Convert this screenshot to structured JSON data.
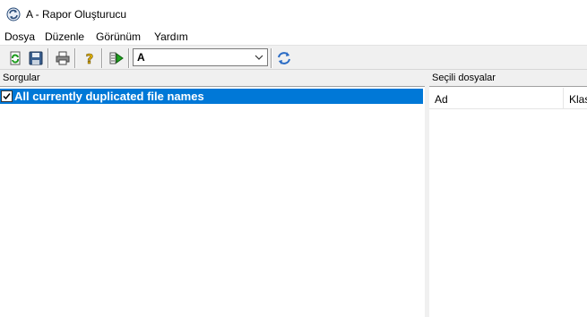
{
  "window": {
    "title": "A - Rapor Oluşturucu",
    "icon": "refresh-app-icon"
  },
  "menu": {
    "items": [
      "Dosya",
      "Düzenle",
      "Görünüm",
      "Yardım"
    ]
  },
  "toolbar": {
    "buttons": [
      "refresh-icon",
      "save-icon",
      "print-icon",
      "help-icon",
      "run-icon",
      "reload-icon"
    ],
    "combo_value": "A"
  },
  "left_pane": {
    "header": "Sorgular",
    "queries": [
      {
        "label": "All currently duplicated file names",
        "checked": true
      }
    ]
  },
  "right_pane": {
    "header": "Seçili dosyalar",
    "columns": [
      "Ad",
      "Klas"
    ]
  },
  "colors": {
    "selection": "#0078d7",
    "toolbar_bg": "#f0f0f0"
  }
}
